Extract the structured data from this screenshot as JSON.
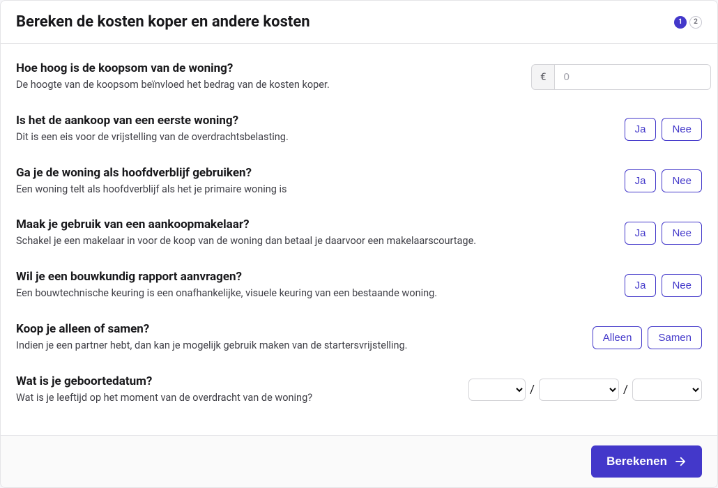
{
  "header": {
    "title": "Bereken de kosten koper en andere kosten",
    "step_active": "1",
    "step_next": "2"
  },
  "questions": {
    "purchase_price": {
      "title": "Hoe hoog is de koopsom van de woning?",
      "sub": "De hoogte van de koopsom beïnvloed het bedrag van de kosten koper.",
      "currency": "€",
      "placeholder": "0"
    },
    "first_home": {
      "title": "Is het de aankoop van een eerste woning?",
      "sub": "Dit is een eis voor de vrijstelling van de overdrachtsbelasting.",
      "yes": "Ja",
      "no": "Nee"
    },
    "primary_residence": {
      "title": "Ga je de woning als hoofdverblijf gebruiken?",
      "sub": "Een woning telt als hoofdverblijf als het je primaire woning is",
      "yes": "Ja",
      "no": "Nee"
    },
    "buyers_agent": {
      "title": "Maak je gebruik van een aankoopmakelaar?",
      "sub": "Schakel je een makelaar in voor de koop van de woning dan betaal je daarvoor een makelaarscourtage.",
      "yes": "Ja",
      "no": "Nee"
    },
    "building_report": {
      "title": "Wil je een bouwkundig rapport aanvragen?",
      "sub": "Een bouwtechnische keuring is een onafhankelijke, visuele keuring van een bestaande woning.",
      "yes": "Ja",
      "no": "Nee"
    },
    "alone_or_together": {
      "title": "Koop je alleen of samen?",
      "sub": "Indien je een partner hebt, dan kan je mogelijk gebruik maken van de startersvrijstelling.",
      "alone": "Alleen",
      "together": "Samen"
    },
    "birthdate": {
      "title": "Wat is je geboortedatum?",
      "sub": "Wat is je leeftijd op het moment van de overdracht van de woning?",
      "sep": "/"
    }
  },
  "footer": {
    "submit": "Berekenen"
  }
}
